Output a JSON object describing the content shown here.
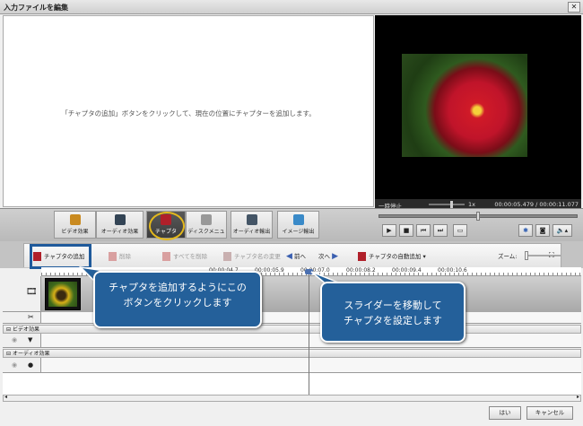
{
  "window": {
    "title": "入力ファイルを編集",
    "close": "✕"
  },
  "left_pane": {
    "message": "「チャプタの追加」ボタンをクリックして、現在の位置にチャプターを追加します。"
  },
  "player": {
    "state": "一時停止",
    "speed": "1x",
    "time": "00:00:05.479 / 00:00:11.077",
    "seek_fraction": 0.495
  },
  "toolbar": {
    "buttons": [
      {
        "label": "ビデオ効果",
        "icon": "video-effects-icon"
      },
      {
        "label": "オーディオ効果",
        "icon": "audio-effects-icon"
      },
      {
        "label": "チャプタ",
        "icon": "chapter-icon",
        "active": true
      },
      {
        "label": "ディスクメニュ",
        "icon": "disc-menu-icon"
      },
      {
        "label": "オーディオ輸出",
        "icon": "audio-export-icon"
      },
      {
        "label": "イメージ輸出",
        "icon": "image-export-icon"
      }
    ],
    "player_controls": [
      "play-icon",
      "stop-icon",
      "prev-icon",
      "next-icon",
      "battery-icon"
    ],
    "player_extra": [
      "snapshot-settings-icon",
      "camera-icon",
      "volume-icon"
    ]
  },
  "chapter_bar": {
    "add": "チャプタの追加",
    "delete": "削除",
    "delete_all": "すべてを削除",
    "rename": "チャプタ名の変更",
    "prev": "前へ",
    "next": "次へ",
    "auto_add": "チャプタの自動追加",
    "zoom": "ズーム:"
  },
  "ruler": {
    "ticks": [
      "00:00:04.7",
      "00:00:05.9",
      "00:00:07.0",
      "00:00:08.2",
      "00:00:09.4",
      "00:00:10.6"
    ]
  },
  "tracks": {
    "video_effects": "ビデオ効果",
    "audio_effects": "オーディオ効果"
  },
  "callouts": {
    "add_hint": "チャプタを追加するようにこの\nボタンをクリックします",
    "slider_hint": "スライダーを移動して\nチャプタを設定します"
  },
  "footer": {
    "ok": "はい",
    "cancel": "キャンセル"
  },
  "colors": {
    "callout": "#24609a",
    "highlight": "#1f5a9b",
    "ring": "#e3b81c"
  }
}
